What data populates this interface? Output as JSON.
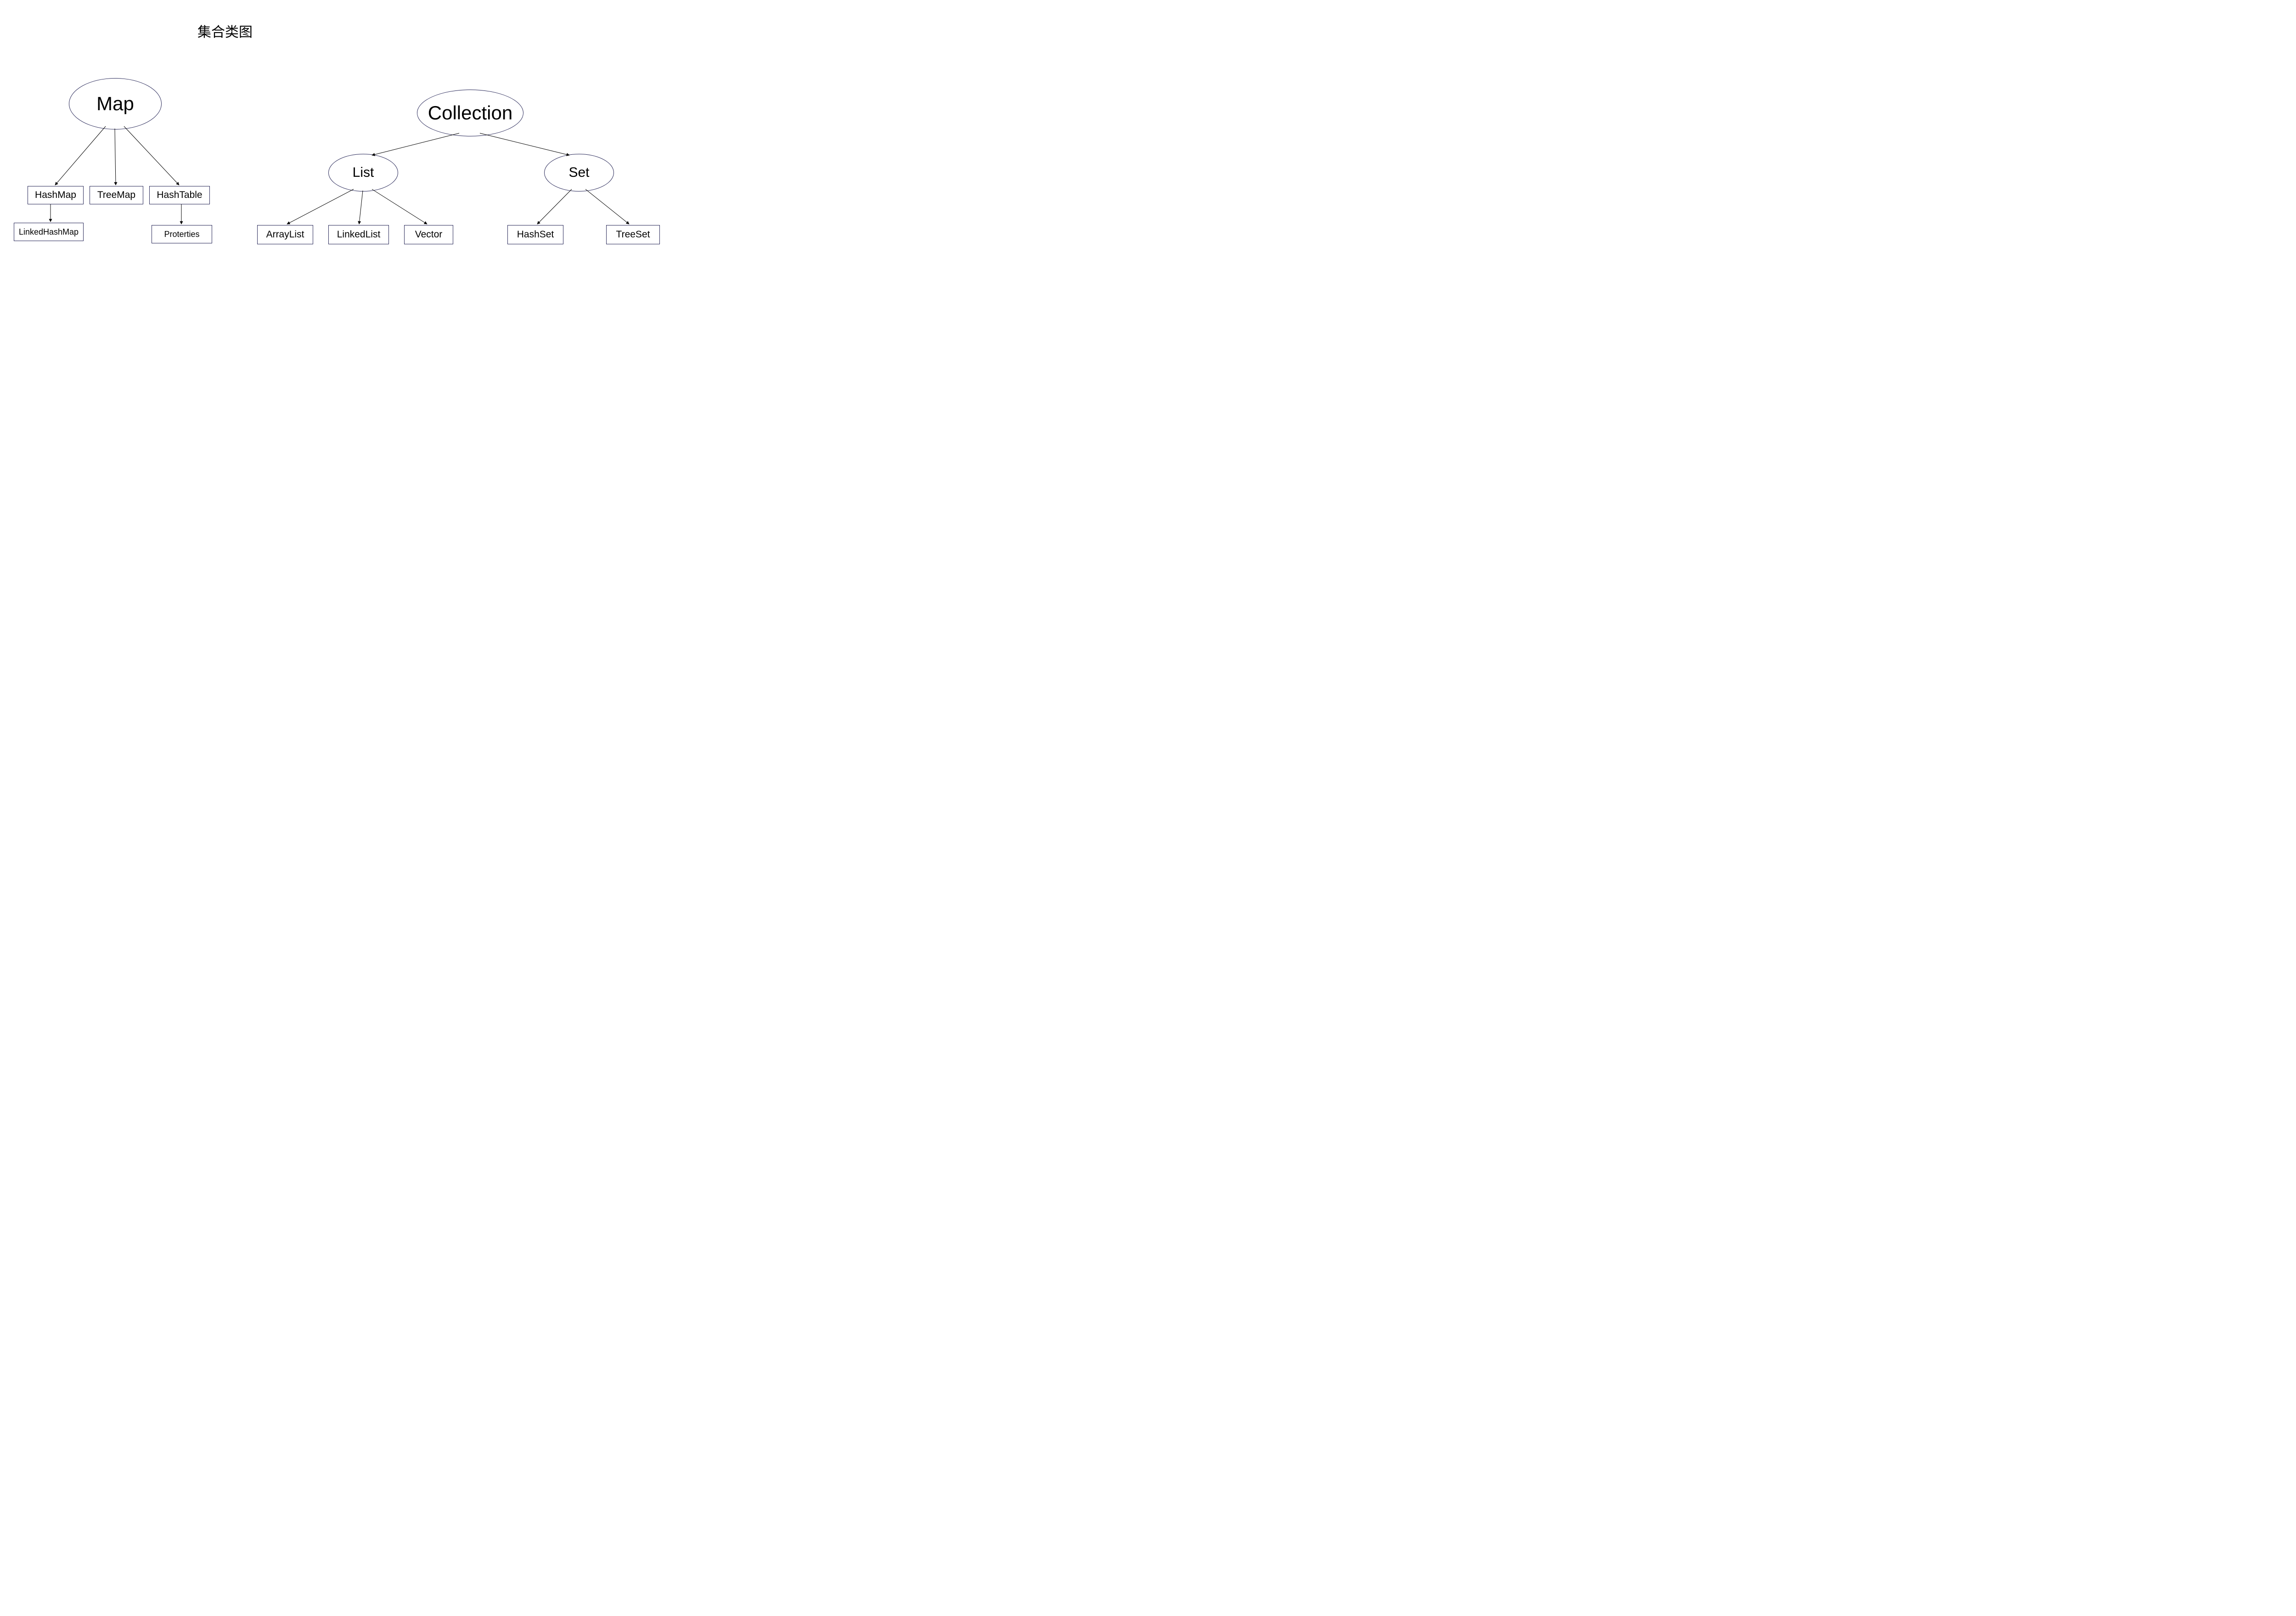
{
  "title": "集合类图",
  "nodes": {
    "map": "Map",
    "collection": "Collection",
    "list": "List",
    "set": "Set",
    "hashmap": "HashMap",
    "treemap": "TreeMap",
    "hashtable": "HashTable",
    "linkedhashmap": "LinkedHashMap",
    "properties": "Proterties",
    "arraylist": "ArrayList",
    "linkedlist": "LinkedList",
    "vector": "Vector",
    "hashset": "HashSet",
    "treeset": "TreeSet"
  }
}
